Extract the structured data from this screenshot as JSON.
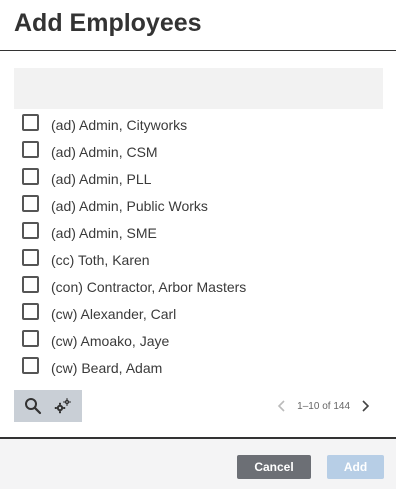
{
  "dialog": {
    "title": "Add Employees"
  },
  "employees": [
    {
      "label": "(ad) Admin, Cityworks",
      "checked": false
    },
    {
      "label": "(ad) Admin, CSM",
      "checked": false
    },
    {
      "label": "(ad) Admin, PLL",
      "checked": false
    },
    {
      "label": "(ad) Admin, Public Works",
      "checked": false
    },
    {
      "label": "(ad) Admin, SME",
      "checked": false
    },
    {
      "label": "(cc) Toth, Karen",
      "checked": false
    },
    {
      "label": "(con) Contractor, Arbor Masters",
      "checked": false
    },
    {
      "label": "(cw) Alexander, Carl",
      "checked": false
    },
    {
      "label": "(cw) Amoako, Jaye",
      "checked": false
    },
    {
      "label": "(cw) Beard, Adam",
      "checked": false
    }
  ],
  "toolbar": {
    "search_icon": "search-icon",
    "settings_icon": "gears-icon"
  },
  "pager": {
    "info": "1–10 of 144",
    "prev_icon": "chevron-left-icon",
    "next_icon": "chevron-right-icon"
  },
  "footer": {
    "cancel_label": "Cancel",
    "add_label": "Add"
  },
  "colors": {
    "cancel_bg": "#6c6f75",
    "add_bg_disabled": "#b7cee6",
    "toolbar_bg": "#c9cfd6"
  }
}
